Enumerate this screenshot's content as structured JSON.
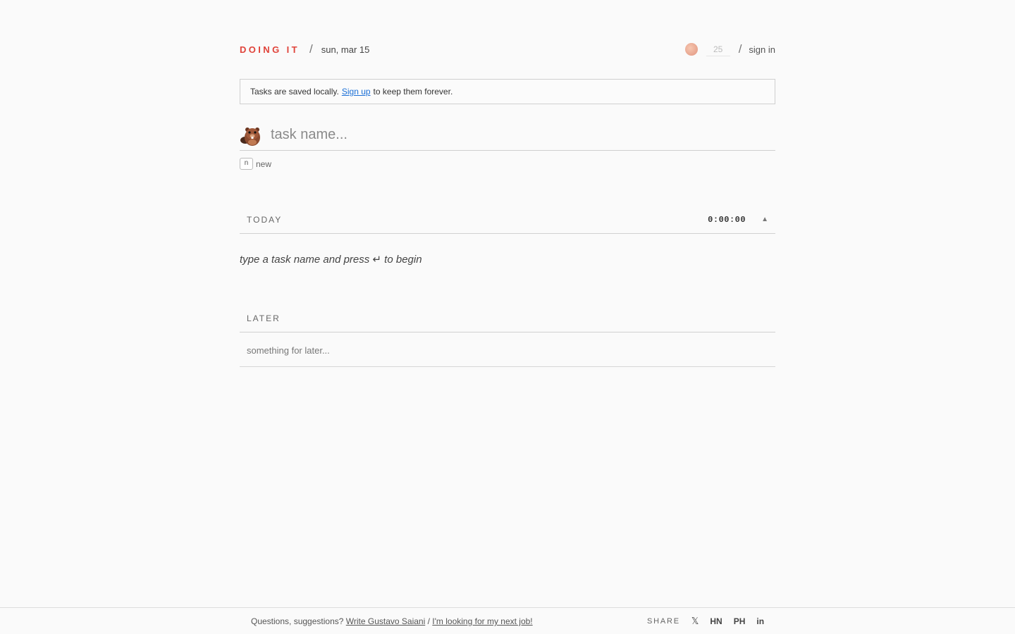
{
  "header": {
    "brand": "DOING IT",
    "separator": "/",
    "date": "sun, mar 15",
    "pomodoro_value": "25",
    "signin_label": "sign in"
  },
  "notice": {
    "prefix": "Tasks are saved locally.",
    "link_label": "Sign up",
    "suffix": "to keep them forever."
  },
  "task_input": {
    "placeholder": "task name...",
    "hint_key": "n",
    "hint_label": "new"
  },
  "today": {
    "title": "TODAY",
    "timer": "0:00:00",
    "collapse_icon": "▲",
    "empty_message": "type a task name and press ↵ to begin"
  },
  "later": {
    "title": "LATER",
    "placeholder": "something for later..."
  },
  "footer": {
    "question": "Questions, suggestions?",
    "contact_link": "Write Gustavo Saiani",
    "divider": "/",
    "job_link": "I'm looking for my next job!",
    "share_label": "SHARE",
    "share_links": [
      "𝕏",
      "HN",
      "PH",
      "in"
    ]
  },
  "colors": {
    "brand": "#e0433a",
    "link": "#1a6fd6",
    "background": "#fafafa"
  }
}
